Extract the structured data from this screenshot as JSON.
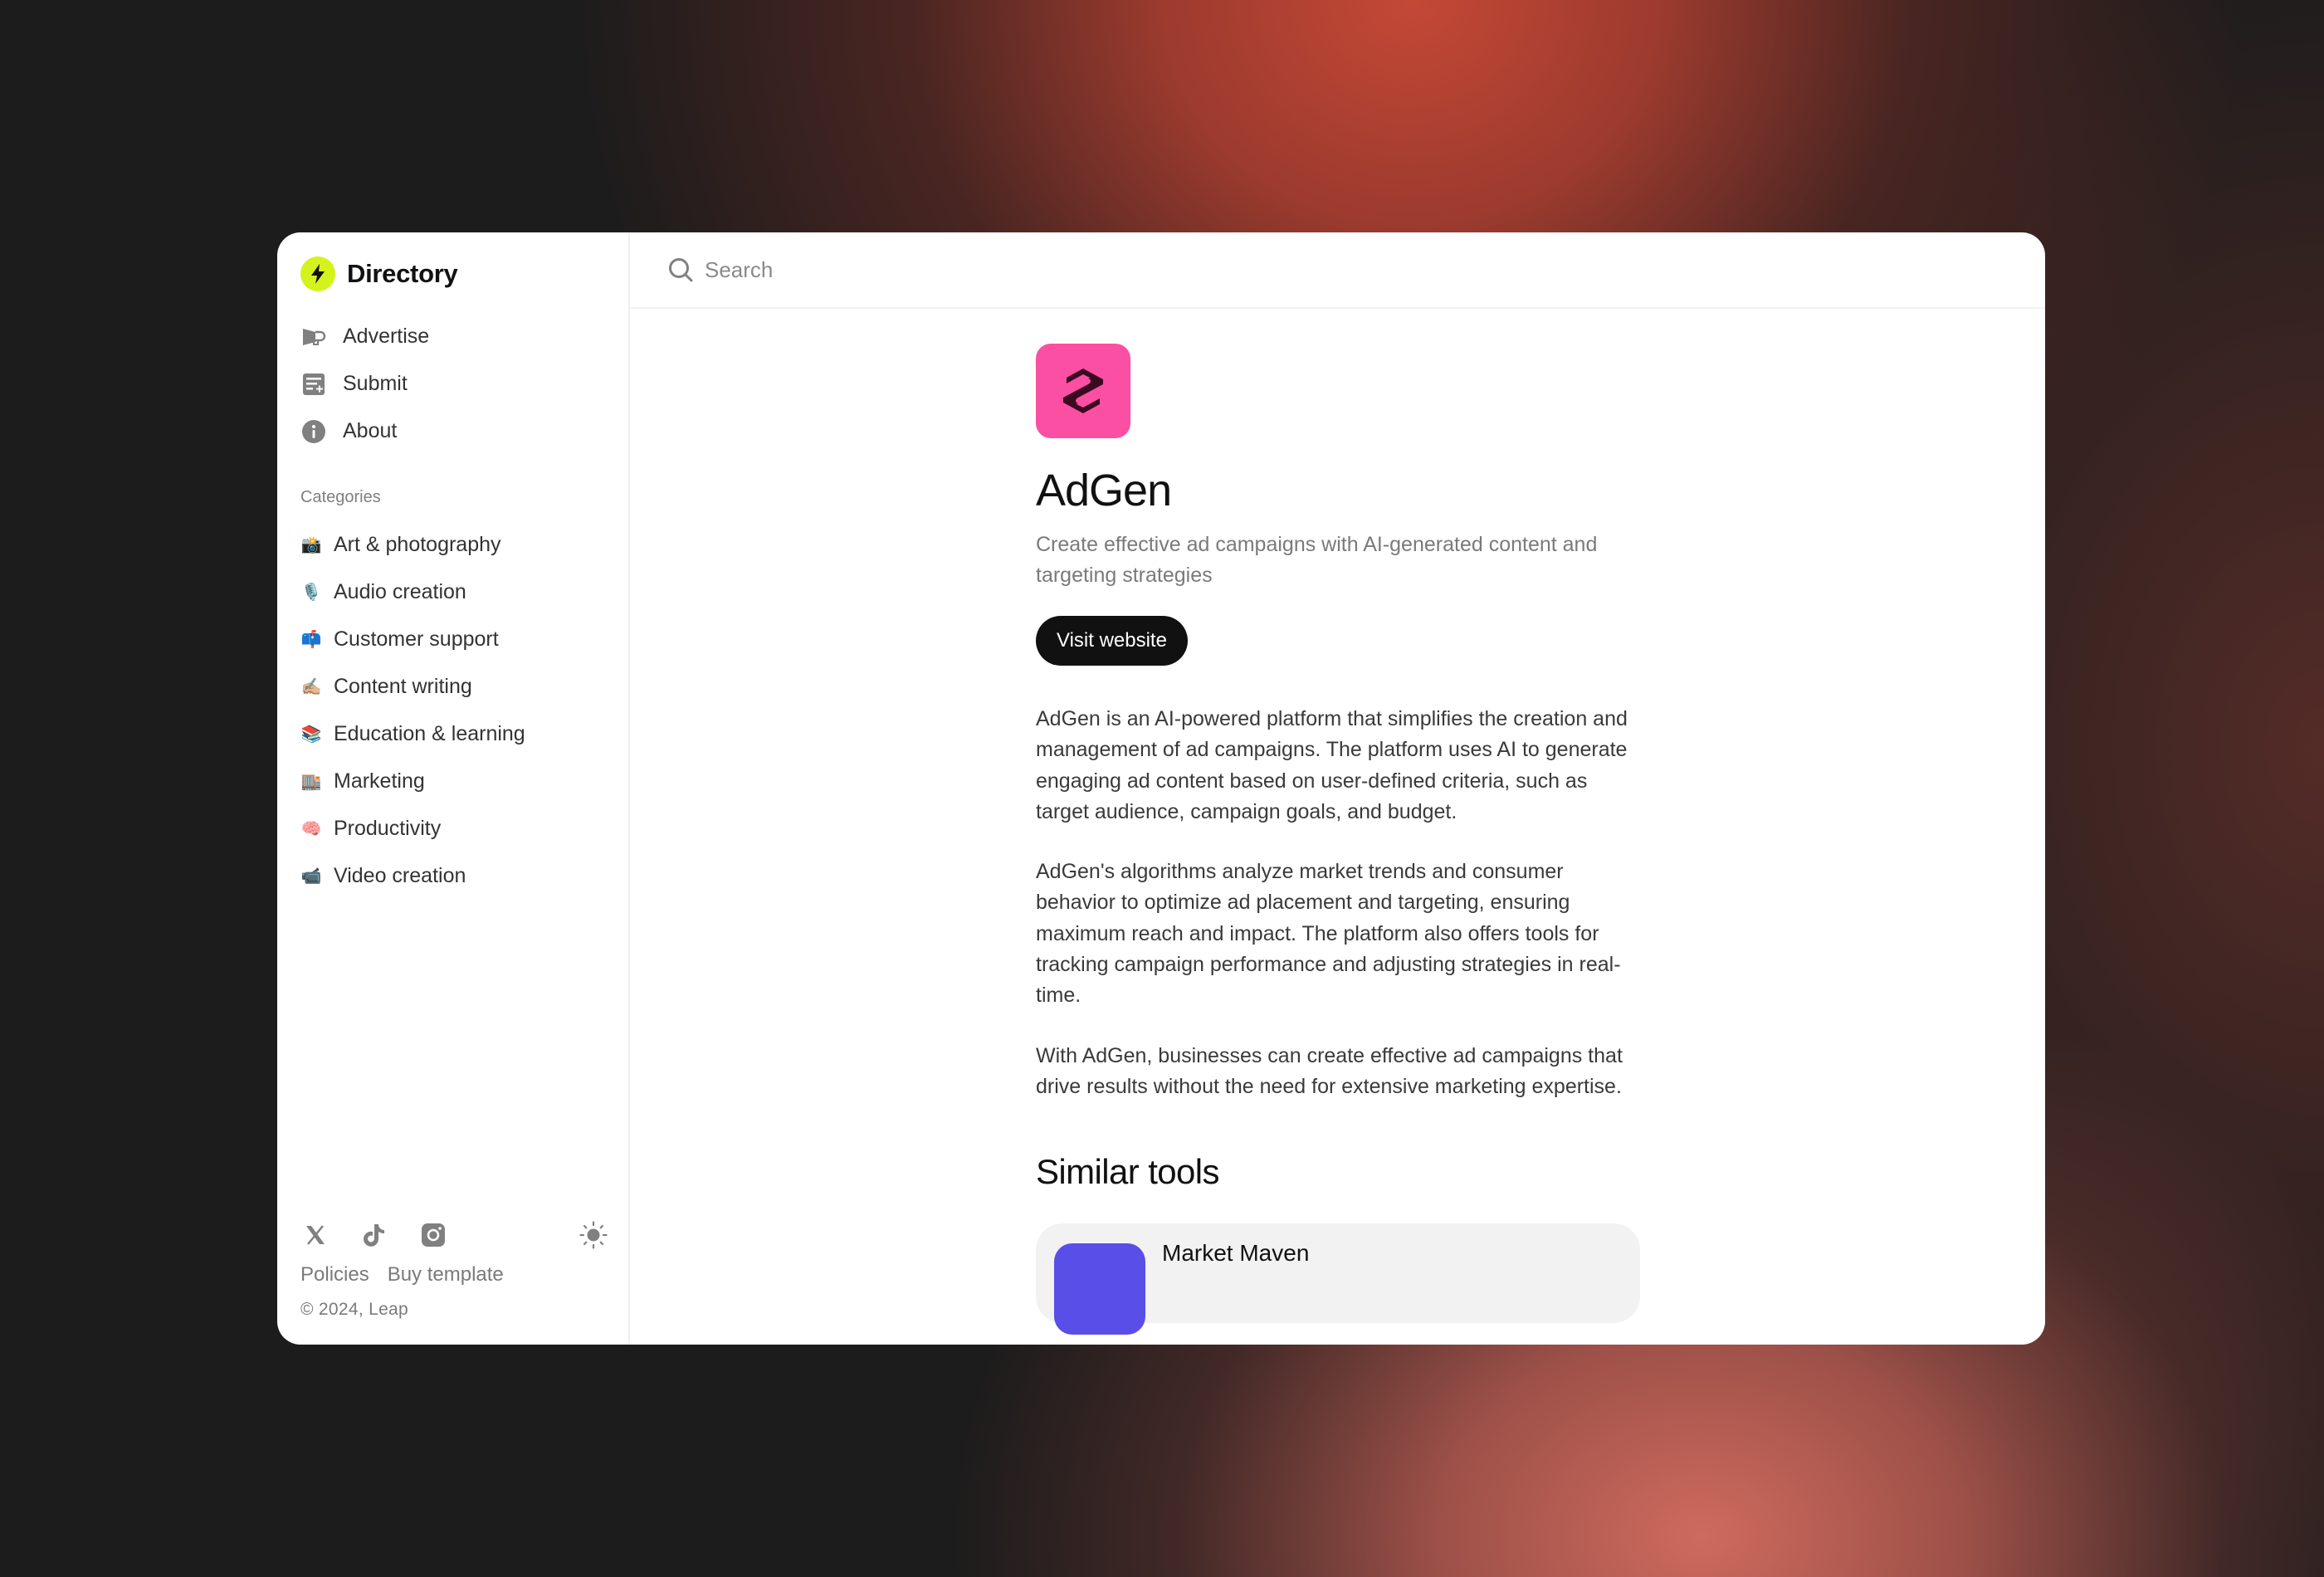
{
  "app": {
    "brand_name": "Directory",
    "accent_color": "#d4f21c"
  },
  "sidebar": {
    "nav": [
      {
        "label": "Advertise",
        "icon": "megaphone-icon"
      },
      {
        "label": "Submit",
        "icon": "submit-form-icon"
      },
      {
        "label": "About",
        "icon": "info-icon"
      }
    ],
    "categories_header": "Categories",
    "categories": [
      {
        "emoji": "📸",
        "label": "Art & photography"
      },
      {
        "emoji": "🎙️",
        "label": "Audio creation"
      },
      {
        "emoji": "📫",
        "label": "Customer support"
      },
      {
        "emoji": "✍🏼",
        "label": "Content writing"
      },
      {
        "emoji": "📚",
        "label": "Education & learning"
      },
      {
        "emoji": "🏬",
        "label": "Marketing"
      },
      {
        "emoji": "🧠",
        "label": "Productivity"
      },
      {
        "emoji": "📹",
        "label": "Video creation"
      }
    ],
    "footer": {
      "social": [
        "x-icon",
        "tiktok-icon",
        "instagram-icon"
      ],
      "theme_toggle": "sun-icon",
      "links": [
        "Policies",
        "Buy template"
      ],
      "copyright": "© 2024, Leap"
    }
  },
  "search": {
    "placeholder": "Search",
    "value": ""
  },
  "tool": {
    "name": "AdGen",
    "logo_color": "#fb4fa3",
    "tagline": "Create effective ad campaigns with AI-generated content and targeting strategies",
    "visit_label": "Visit website",
    "description": [
      "AdGen is an AI-powered platform that simplifies the creation and management of ad campaigns. The platform uses AI to generate engaging ad content based on user-defined criteria, such as target audience, campaign goals, and budget.",
      "AdGen's algorithms analyze market trends and consumer behavior to optimize ad placement and targeting, ensuring maximum reach and impact. The platform also offers tools for tracking campaign performance and adjusting strategies in real-time.",
      "With AdGen, businesses can create effective ad campaigns that drive results without the need for extensive marketing expertise."
    ]
  },
  "similar": {
    "title": "Similar tools",
    "items": [
      {
        "name": "Market Maven",
        "logo_color": "#5a4ee8"
      }
    ]
  }
}
